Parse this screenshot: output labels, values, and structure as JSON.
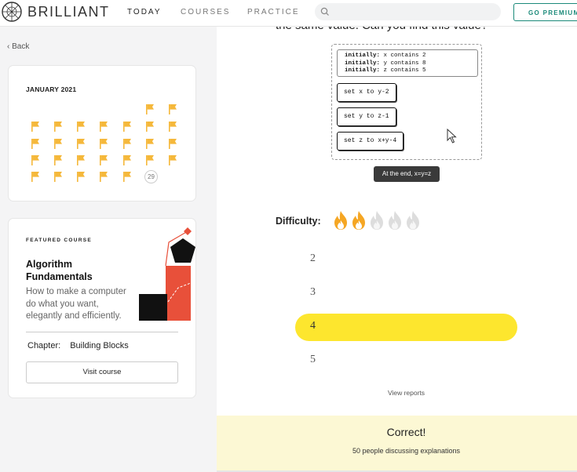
{
  "app": {
    "logo_text": "BRILLIANT"
  },
  "nav": {
    "items": [
      {
        "label": "TODAY",
        "active": true
      },
      {
        "label": "COURSES",
        "active": false
      },
      {
        "label": "PRACTICE",
        "active": false
      }
    ],
    "search_placeholder": "",
    "premium_label": "GO PREMIUM"
  },
  "sidebar": {
    "back_label": "Back",
    "calendar": {
      "title": "JANUARY 2021",
      "today_badge": "29",
      "flag_color": "#f5b83b"
    },
    "featured": {
      "label": "FEATURED COURSE",
      "title": "Algorithm Fundamentals",
      "description": "How to make a computer do what you want, elegantly and efficiently.",
      "chapter_label": "Chapter:",
      "chapter_value": "Building Blocks",
      "visit_label": "Visit course"
    }
  },
  "problem": {
    "question_text": "the same value. Can you find this value?",
    "initial_state": [
      {
        "keyword": "initially:",
        "rest": "x contains 2"
      },
      {
        "keyword": "initially:",
        "rest": "y contains 8"
      },
      {
        "keyword": "initially:",
        "rest": "z contains 5"
      }
    ],
    "steps": [
      "set x to y-2",
      "set y to z-1",
      "set z to x+y-4"
    ],
    "end_note": "At the end, x=y=z",
    "difficulty_label": "Difficulty:",
    "difficulty_level": 2,
    "difficulty_max": 5,
    "flame_active_color": "#f5a623",
    "flame_inactive_color": "#dddddd"
  },
  "choices": [
    {
      "label": "2",
      "selected": false
    },
    {
      "label": "3",
      "selected": false
    },
    {
      "label": "4",
      "selected": true
    },
    {
      "label": "5",
      "selected": false
    }
  ],
  "choice_selected_color": "#fde62e",
  "view_reports_label": "View reports",
  "result": {
    "title": "Correct!",
    "subtitle": "50 people discussing explanations"
  }
}
